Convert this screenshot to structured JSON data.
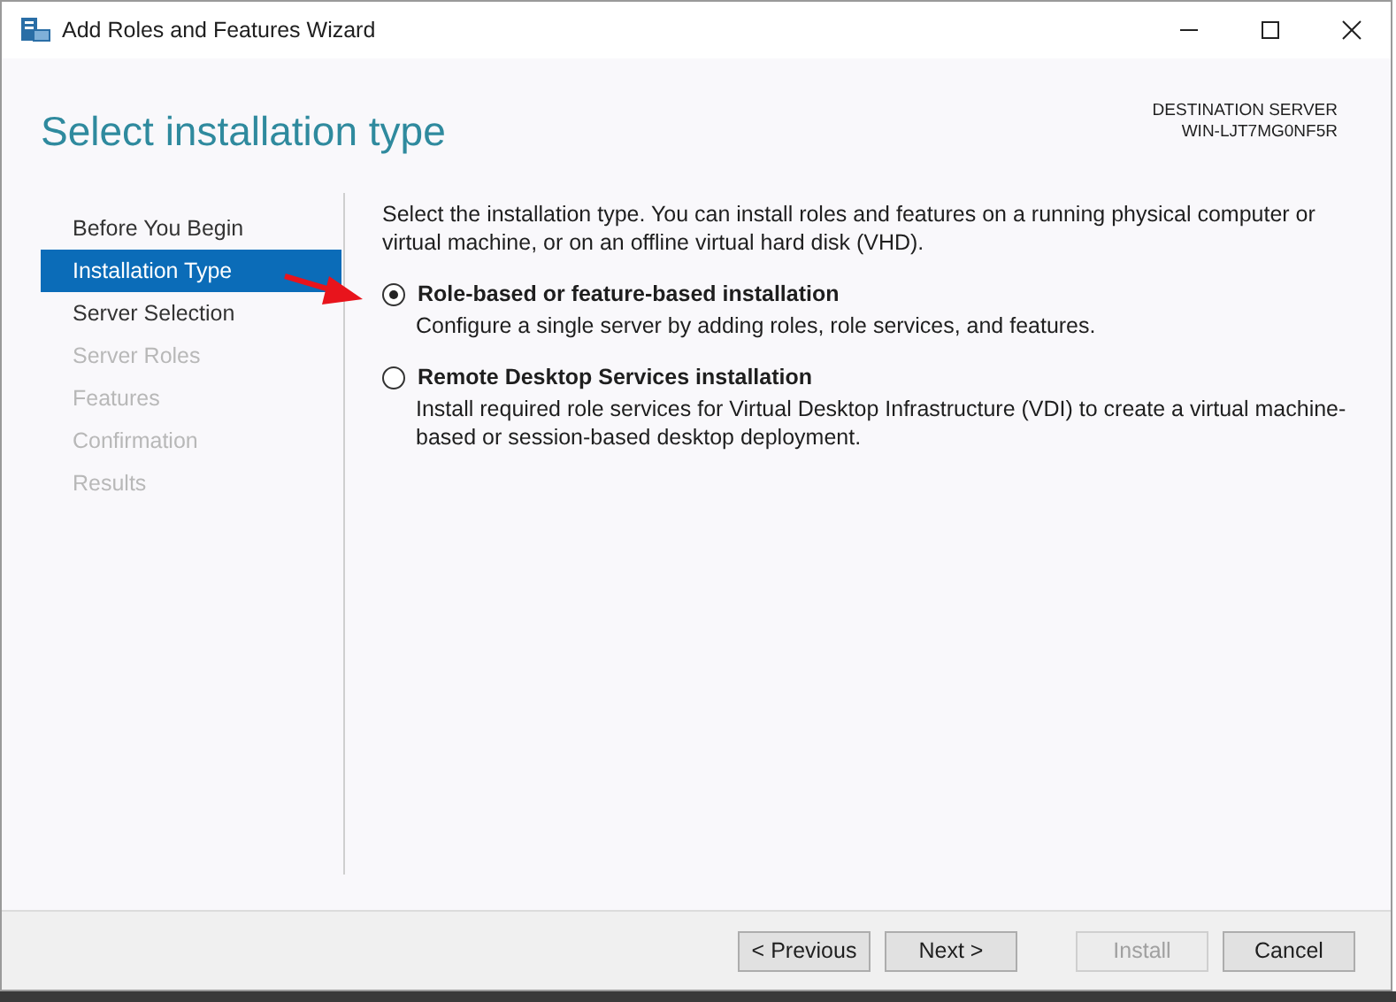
{
  "window": {
    "title": "Add Roles and Features Wizard"
  },
  "header": {
    "title": "Select installation type",
    "destination_label": "DESTINATION SERVER",
    "destination_server": "WIN-LJT7MG0NF5R"
  },
  "steps": [
    {
      "label": "Before You Begin",
      "selected": false,
      "disabled": false
    },
    {
      "label": "Installation Type",
      "selected": true,
      "disabled": false
    },
    {
      "label": "Server Selection",
      "selected": false,
      "disabled": false
    },
    {
      "label": "Server Roles",
      "selected": false,
      "disabled": true
    },
    {
      "label": "Features",
      "selected": false,
      "disabled": true
    },
    {
      "label": "Confirmation",
      "selected": false,
      "disabled": true
    },
    {
      "label": "Results",
      "selected": false,
      "disabled": true
    }
  ],
  "intro": "Select the installation type. You can install roles and features on a running physical computer or virtual machine, or on an offline virtual hard disk (VHD).",
  "options": [
    {
      "label": "Role-based or feature-based installation",
      "description": "Configure a single server by adding roles, role services, and features.",
      "selected": true
    },
    {
      "label": "Remote Desktop Services installation",
      "description": "Install required role services for Virtual Desktop Infrastructure (VDI) to create a virtual machine-based or session-based desktop deployment.",
      "selected": false
    }
  ],
  "buttons": [
    {
      "label": "< Previous",
      "disabled": false
    },
    {
      "label": "Next >",
      "disabled": false
    },
    {
      "label": "Install",
      "disabled": true
    },
    {
      "label": "Cancel",
      "disabled": false
    }
  ]
}
